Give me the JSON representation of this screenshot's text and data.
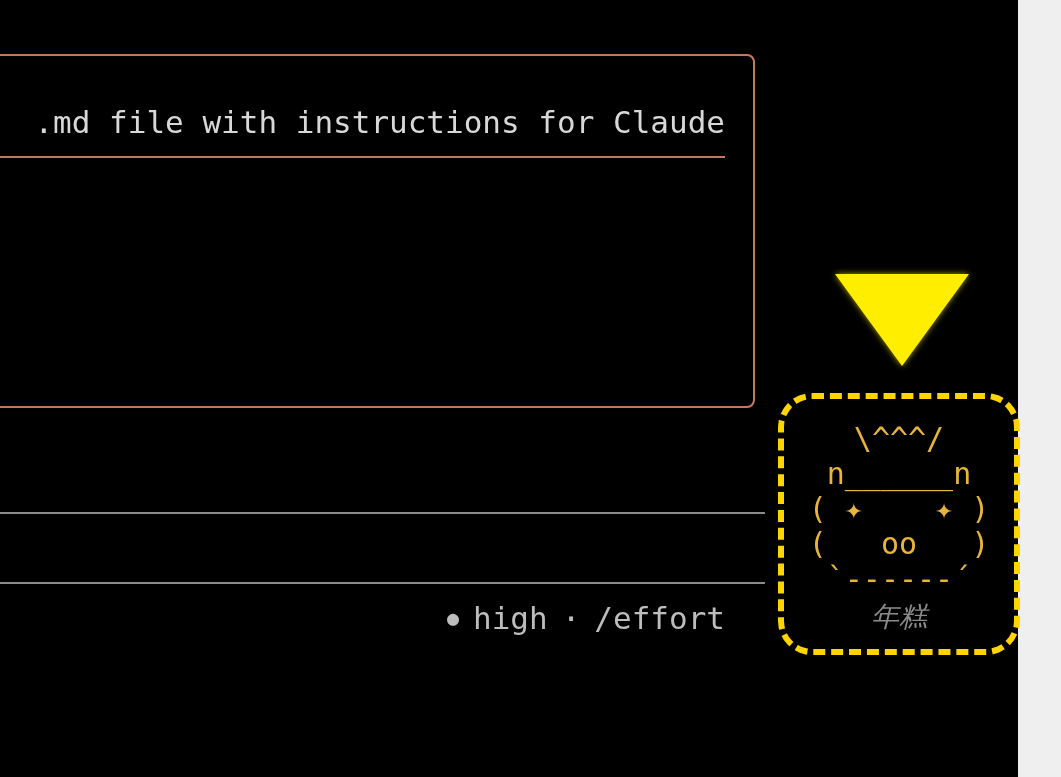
{
  "prompt_box": {
    "text": ".md file with instructions for Claude"
  },
  "status": {
    "dot": "●",
    "effort": "high",
    "separator": "·",
    "command": "/effort"
  },
  "mascot": {
    "art": [
      "\\^^^/",
      "n______n",
      "( ✦    ✦ )",
      "(   oo   )",
      "`------´"
    ],
    "name": "年糕"
  }
}
